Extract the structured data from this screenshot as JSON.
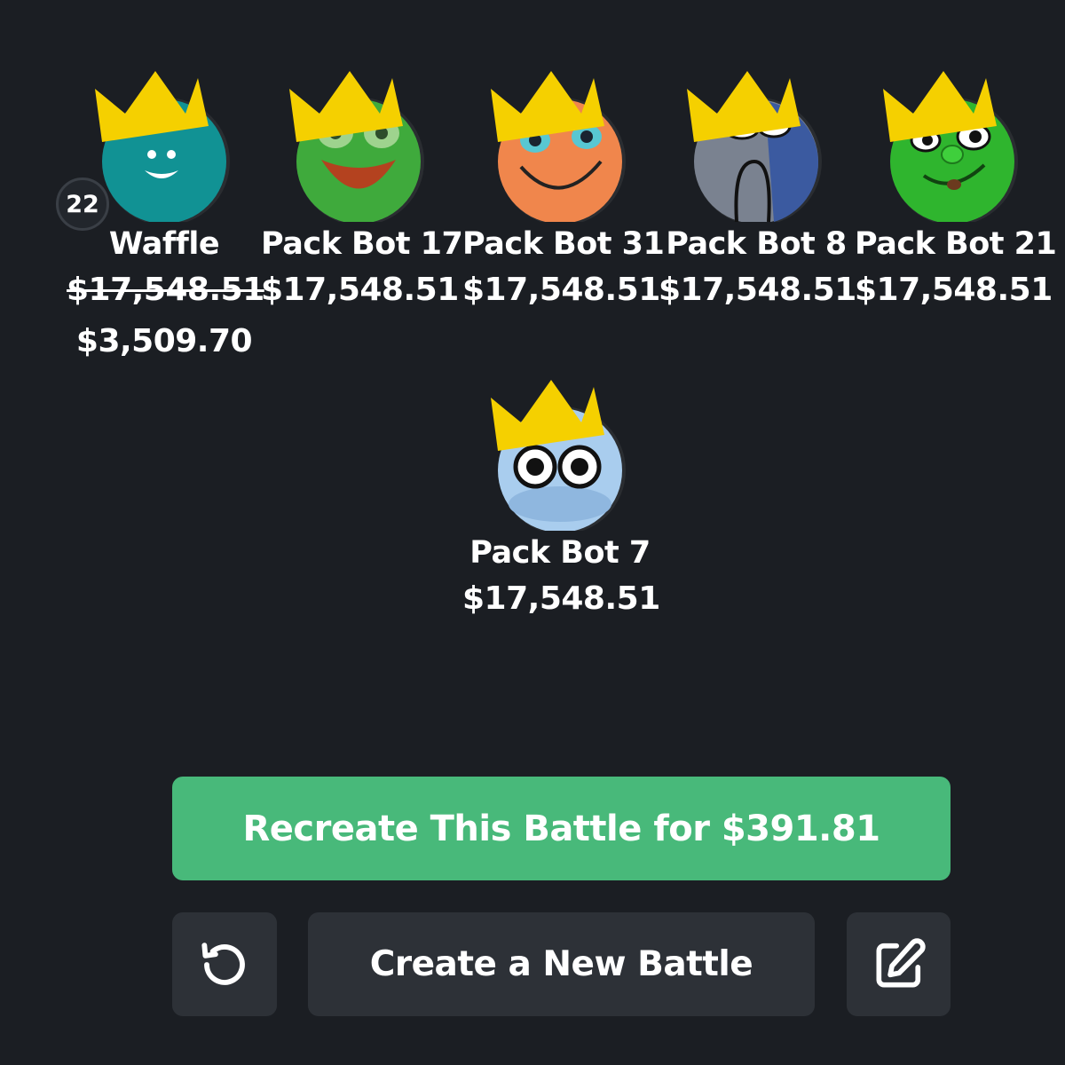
{
  "players": [
    {
      "name": "Waffle",
      "original_price": "$17,548.51",
      "price": "$3,509.70",
      "level": "22",
      "avatar": "teal-smiley-avatar",
      "crown": "crown-icon"
    },
    {
      "name": "Pack Bot 17",
      "price": "$17,548.51",
      "avatar": "green-frog-avatar",
      "crown": "crown-icon"
    },
    {
      "name": "Pack Bot 31",
      "price": "$17,548.51",
      "avatar": "orange-face-avatar",
      "crown": "crown-icon"
    },
    {
      "name": "Pack Bot 8",
      "price": "$17,548.51",
      "avatar": "gray-blue-ghost-avatar",
      "crown": "crown-icon"
    },
    {
      "name": "Pack Bot 21",
      "price": "$17,548.51",
      "avatar": "green-goofy-avatar",
      "crown": "crown-icon"
    },
    {
      "name": "Pack Bot 7",
      "price": "$17,548.51",
      "avatar": "light-blue-eyes-avatar",
      "crown": "crown-icon"
    }
  ],
  "actions": {
    "recreate_label": "Recreate This Battle for $391.81",
    "create_label": "Create a New Battle",
    "replay_icon": "replay-icon",
    "edit_icon": "edit-icon"
  },
  "colors": {
    "background": "#1b1e23",
    "accent_green": "#48b97a",
    "button_dark": "#2d3137",
    "crown": "#f5d000"
  }
}
